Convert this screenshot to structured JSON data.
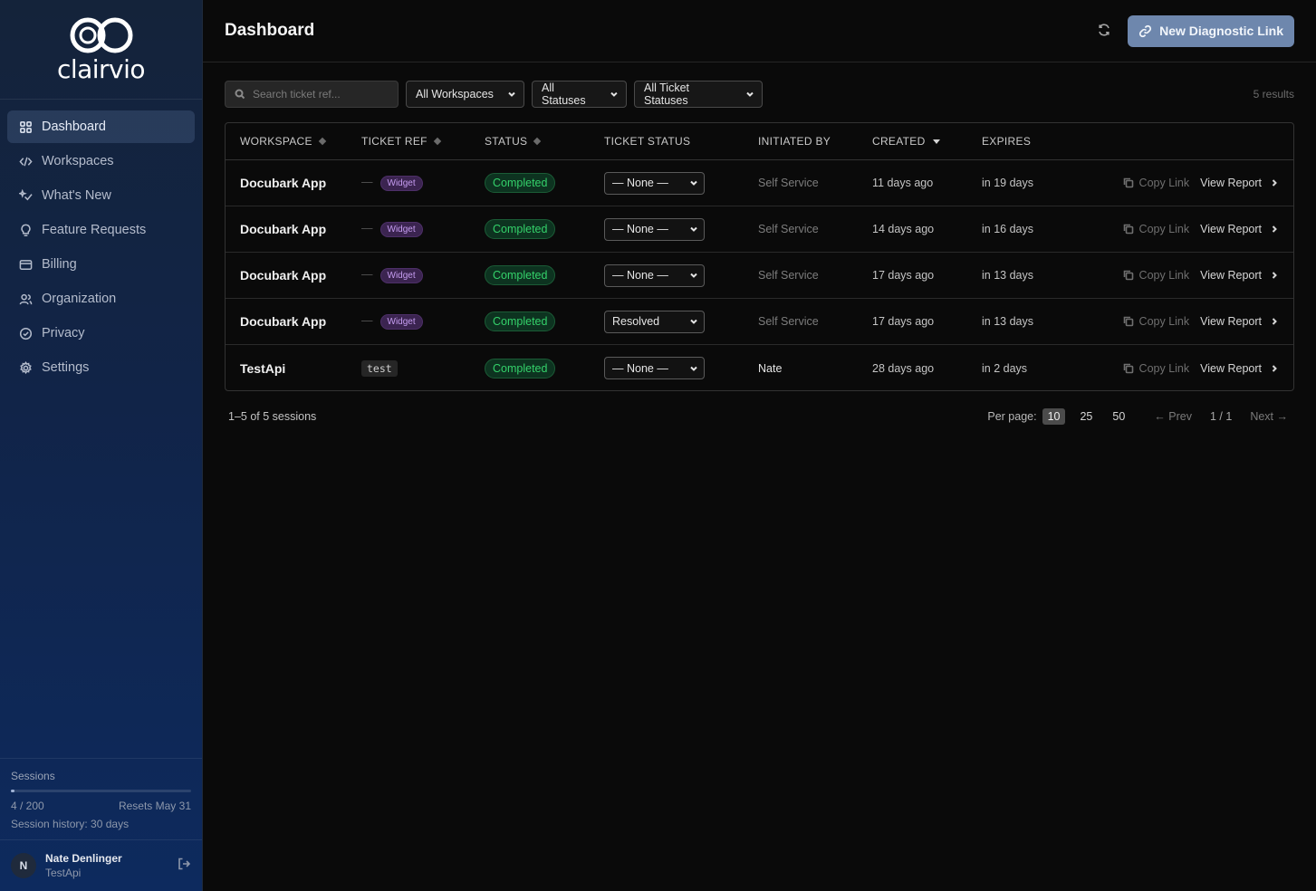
{
  "brand": {
    "name": "clairvio"
  },
  "sidebar": {
    "items": [
      {
        "label": "Dashboard",
        "icon": "grid-icon",
        "active": true
      },
      {
        "label": "Workspaces",
        "icon": "code-icon"
      },
      {
        "label": "What's New",
        "icon": "sparkle-icon"
      },
      {
        "label": "Feature Requests",
        "icon": "lightbulb-icon"
      },
      {
        "label": "Billing",
        "icon": "credit-card-icon"
      },
      {
        "label": "Organization",
        "icon": "users-icon"
      },
      {
        "label": "Privacy",
        "icon": "check-circle-icon"
      },
      {
        "label": "Settings",
        "icon": "gear-icon"
      }
    ],
    "usage": {
      "title": "Sessions",
      "count": "4 / 200",
      "fraction": 0.02,
      "resets": "Resets May 31",
      "history": "Session history: 30 days"
    },
    "user": {
      "initial": "N",
      "name": "Nate Denlinger",
      "org": "TestApi"
    }
  },
  "header": {
    "title": "Dashboard",
    "new_button": "New Diagnostic Link"
  },
  "filters": {
    "search_placeholder": "Search ticket ref...",
    "workspace": "All Workspaces",
    "status": "All Statuses",
    "ticket_status": "All Ticket Statuses",
    "results": "5 results"
  },
  "table": {
    "headers": [
      "WORKSPACE",
      "TICKET REF",
      "STATUS",
      "TICKET STATUS",
      "INITIATED BY",
      "CREATED",
      "EXPIRES"
    ],
    "copy_label": "Copy Link",
    "view_label": "View Report",
    "rows": [
      {
        "workspace": "Docubark App",
        "dash": "—",
        "ref": "Widget",
        "status": "Completed",
        "ticket_status": "— None —",
        "initiated": "Self Service",
        "created": "11 days ago",
        "expires": "in 19 days"
      },
      {
        "workspace": "Docubark App",
        "dash": "—",
        "ref": "Widget",
        "status": "Completed",
        "ticket_status": "— None —",
        "initiated": "Self Service",
        "created": "14 days ago",
        "expires": "in 16 days"
      },
      {
        "workspace": "Docubark App",
        "dash": "—",
        "ref": "Widget",
        "status": "Completed",
        "ticket_status": "— None —",
        "initiated": "Self Service",
        "created": "17 days ago",
        "expires": "in 13 days"
      },
      {
        "workspace": "Docubark App",
        "dash": "—",
        "ref": "Widget",
        "status": "Completed",
        "ticket_status": "Resolved",
        "initiated": "Self Service",
        "created": "17 days ago",
        "expires": "in 13 days"
      },
      {
        "workspace": "TestApi",
        "ref": "test",
        "status": "Completed",
        "ticket_status": "— None —",
        "initiated": "Nate",
        "created": "28 days ago",
        "expires": "in 2 days"
      }
    ]
  },
  "footer": {
    "summary": "1–5 of 5 sessions",
    "per_page_label": "Per page:",
    "per_page_options": [
      "10",
      "25",
      "50"
    ],
    "prev": "← Prev",
    "page": "1 / 1",
    "next": "Next →"
  }
}
